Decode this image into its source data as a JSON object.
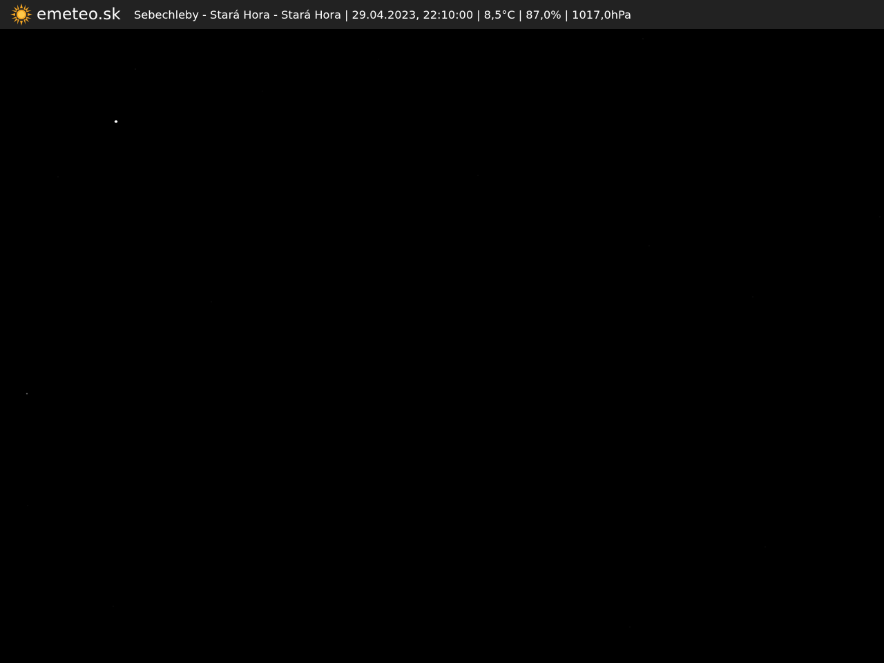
{
  "brand": {
    "name": "emeteo.sk",
    "icon": "sun-icon",
    "accent_color": "#f5a623"
  },
  "caption": {
    "location": "Sebechleby - Stará Hora - Stará Hora",
    "datetime": "29.04.2023, 22:10:00",
    "temperature": "8,5°C",
    "humidity": "87,0%",
    "pressure": "1017,0hPa",
    "separator": "|"
  },
  "scene": {
    "description_colors": {
      "sky": "#000000",
      "bar": "#222222"
    }
  }
}
